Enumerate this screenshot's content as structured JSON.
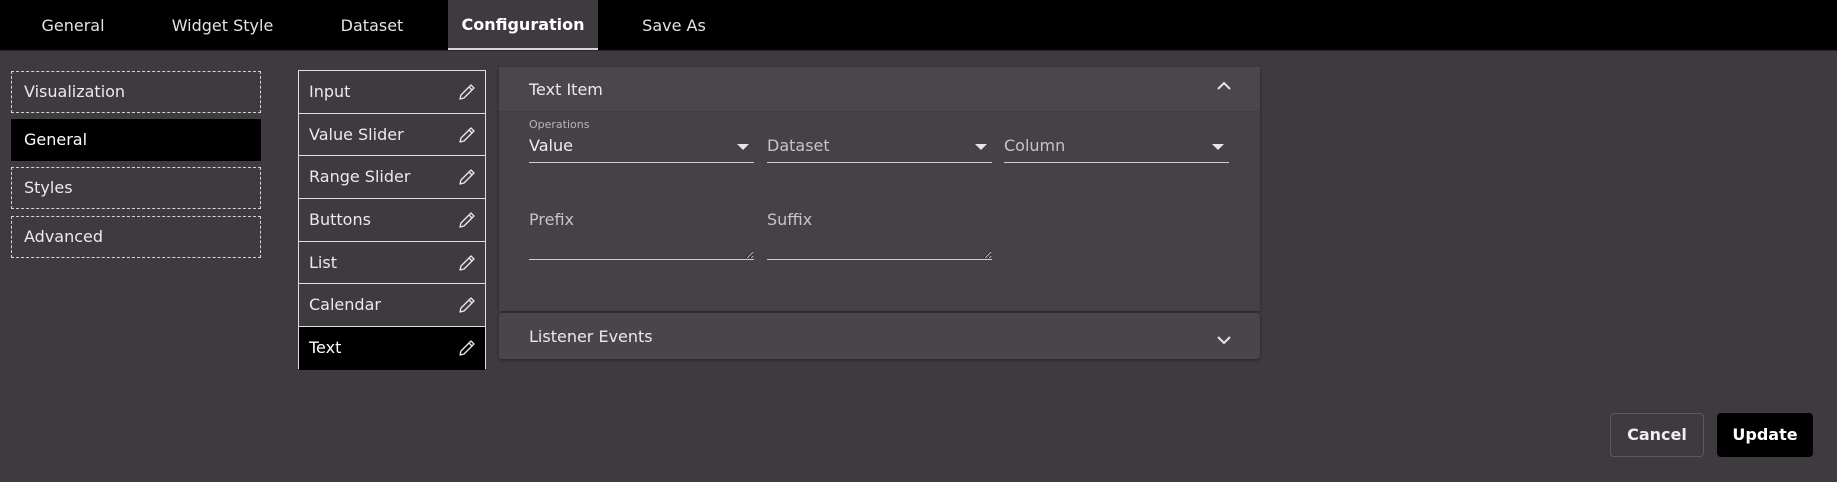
{
  "tabs": [
    {
      "label": "General"
    },
    {
      "label": "Widget Style"
    },
    {
      "label": "Dataset"
    },
    {
      "label": "Configuration",
      "active": true
    },
    {
      "label": "Save As"
    }
  ],
  "sidebar": {
    "items": [
      {
        "label": "Visualization"
      },
      {
        "label": "General",
        "active": true
      },
      {
        "label": "Styles"
      },
      {
        "label": "Advanced"
      }
    ]
  },
  "widgets": {
    "items": [
      {
        "label": "Input"
      },
      {
        "label": "Value Slider"
      },
      {
        "label": "Range Slider"
      },
      {
        "label": "Buttons"
      },
      {
        "label": "List"
      },
      {
        "label": "Calendar"
      },
      {
        "label": "Text",
        "active": true
      }
    ]
  },
  "text_item_panel": {
    "title": "Text Item",
    "operations_label": "Operations",
    "operations_value": "Value",
    "dataset_placeholder": "Dataset",
    "column_placeholder": "Column",
    "prefix_label": "Prefix",
    "suffix_label": "Suffix"
  },
  "listener_panel": {
    "title": "Listener Events"
  },
  "actions": {
    "cancel": "Cancel",
    "update": "Update"
  },
  "colors": {
    "background": "#3f3a3f",
    "topbar": "#000000",
    "active": "#000000"
  },
  "icons": {
    "pencil": "pencil-icon",
    "chevron_up": "chevron-up-icon",
    "chevron_down": "chevron-down-icon"
  }
}
